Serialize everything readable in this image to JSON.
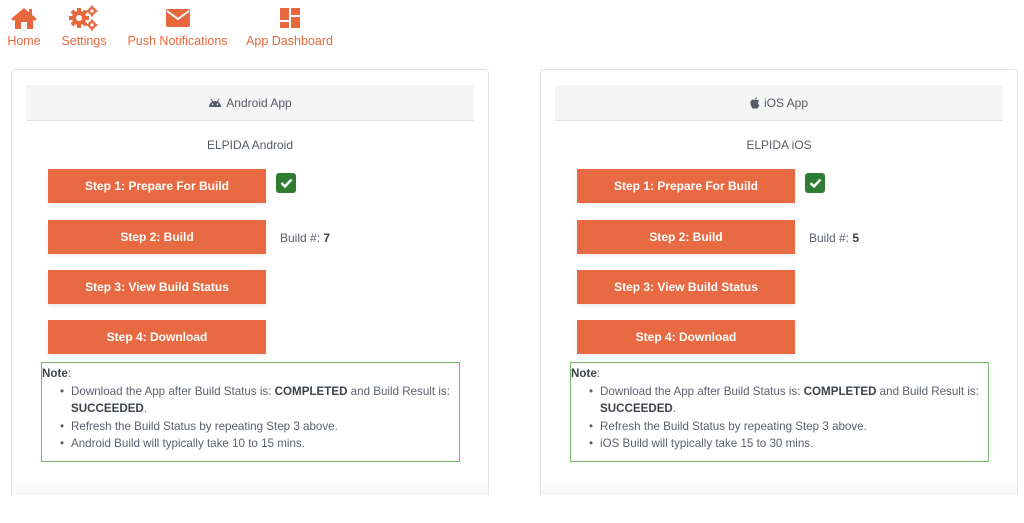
{
  "nav": {
    "items": [
      {
        "label": "Home",
        "icon": "home-icon"
      },
      {
        "label": "Settings",
        "icon": "cogs-icon"
      },
      {
        "label": "Push Notifications",
        "icon": "envelope-icon"
      },
      {
        "label": "App Dashboard",
        "icon": "dashboard-icon"
      }
    ]
  },
  "colors": {
    "accent": "#e86a43",
    "nav_text": "#e8683e",
    "success": "#2e7d32",
    "note_border": "#78b56a"
  },
  "android": {
    "header": "Android App",
    "header_icon": "android-icon",
    "app_name": "ELPIDA Android",
    "steps": [
      "Step 1: Prepare For Build",
      "Step 2: Build",
      "Step 3: View Build Status",
      "Step 4: Download"
    ],
    "step1_complete": true,
    "build_label": "Build #:",
    "build_number": "7",
    "note": {
      "title": "Note",
      "colon": ":",
      "line1_a": "Download the App after Build Status is: ",
      "line1_b": "COMPLETED",
      "line1_c": " and Build Result is: ",
      "line1_d": "SUCCEEDED",
      "line1_e": ".",
      "line2": "Refresh the Build Status by repeating Step 3 above.",
      "line3": "Android Build will typically take 10 to 15 mins."
    }
  },
  "ios": {
    "header": "iOS App",
    "header_icon": "apple-icon",
    "app_name": "ELPIDA iOS",
    "steps": [
      "Step 1: Prepare For Build",
      "Step 2: Build",
      "Step 3: View Build Status",
      "Step 4: Download"
    ],
    "step1_complete": true,
    "build_label": "Build #:",
    "build_number": "5",
    "note": {
      "title": "Note",
      "colon": ":",
      "line1_a": "Download the App after Build Status is: ",
      "line1_b": "COMPLETED",
      "line1_c": " and Build Result is: ",
      "line1_d": "SUCCEEDED",
      "line1_e": ".",
      "line2": "Refresh the Build Status by repeating Step 3 above.",
      "line3": "iOS Build will typically take 15 to 30 mins."
    }
  }
}
